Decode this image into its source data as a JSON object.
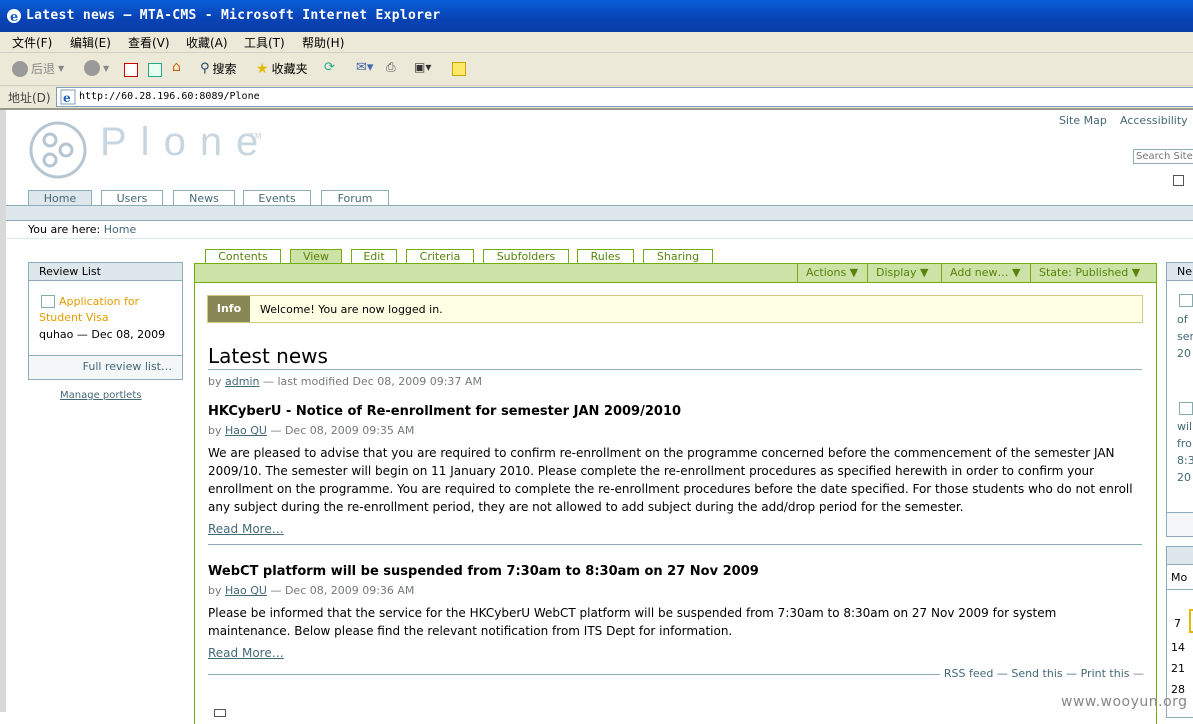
{
  "window": {
    "title": "Latest news — MTA-CMS - Microsoft Internet Explorer"
  },
  "menu": [
    "文件(F)",
    "编辑(E)",
    "查看(V)",
    "收藏(A)",
    "工具(T)",
    "帮助(H)"
  ],
  "toolbar": {
    "back": "后退",
    "search": "搜索",
    "favorites": "收藏夹"
  },
  "address": {
    "label": "地址(D)",
    "url": "http://60.28.196.60:8089/Plone"
  },
  "site": {
    "logo_text": "Plone",
    "logo_tm": "TM",
    "site_actions": [
      "Site Map",
      "Accessibility"
    ],
    "search_placeholder": "Search Site",
    "global_tabs": [
      "Home",
      "Users",
      "News",
      "Events",
      "Forum"
    ],
    "breadcrumb_label": "You are here:",
    "breadcrumb_home": "Home"
  },
  "left_portlet": {
    "title": "Review List",
    "item_link": "Application for Student Visa",
    "item_meta": "quhao — Dec 08, 2009",
    "footer": "Full review list…",
    "manage": "Manage portlets"
  },
  "content_tabs": [
    "Contents",
    "View",
    "Edit",
    "Criteria",
    "Subfolders",
    "Rules",
    "Sharing"
  ],
  "content_actions": [
    "Actions ▼",
    "Display ▼",
    "Add new… ▼",
    "State: Published ▼"
  ],
  "info": {
    "label": "Info",
    "message": "Welcome! You are now logged in."
  },
  "page_title": "Latest news",
  "byline": {
    "by": "by",
    "author": "admin",
    "modified": "— last modified Dec 08, 2009 09:37 AM"
  },
  "news": [
    {
      "title": "HKCyberU - Notice of Re-enrollment for semester JAN 2009/2010",
      "by": "by",
      "author": "Hao QU",
      "date": "— Dec 08, 2009 09:35 AM",
      "body": "We are pleased to advise that you are required to confirm re-enrollment on the programme concerned before the commencement of the semester JAN 2009/10. The semester will begin on 11 January 2010. Please complete the re-enrollment procedures as specified herewith in order to confirm your enrollment on the programme. You are required to complete the re-enrollment procedures before the date specified. For those students who do not enroll any subject during the re-enrollment period, they are not allowed to add subject during the add/drop period for the semester.",
      "more": "Read More…"
    },
    {
      "title": "WebCT platform will be suspended from 7:30am to 8:30am on 27 Nov 2009",
      "by": "by",
      "author": "Hao QU",
      "date": "— Dec 08, 2009 09:36 AM",
      "body": "Please be informed that the service for the HKCyberU WebCT platform will be suspended from 7:30am to 8:30am on 27 Nov 2009 for system maintenance. Below please find the relevant notification from ITS Dept for information.",
      "more": "Read More…"
    }
  ],
  "doc_actions": [
    "RSS feed",
    "— Send this",
    "— Print this",
    "—"
  ],
  "right_portlet": {
    "title_partial": "Ne",
    "lines1": [
      "of",
      "ser",
      "20"
    ],
    "lines2": [
      "wil",
      "fro",
      "8:3",
      "20"
    ],
    "cal_day": "Mo",
    "cal_nums": [
      "7",
      "14",
      "21",
      "28"
    ]
  },
  "watermark": "www.wooyun.org",
  "colors": {
    "title_bar": "#0842b4",
    "plone_link": "#436976",
    "content_green": "#74ae0b",
    "info_bg": "#ffffe3"
  }
}
